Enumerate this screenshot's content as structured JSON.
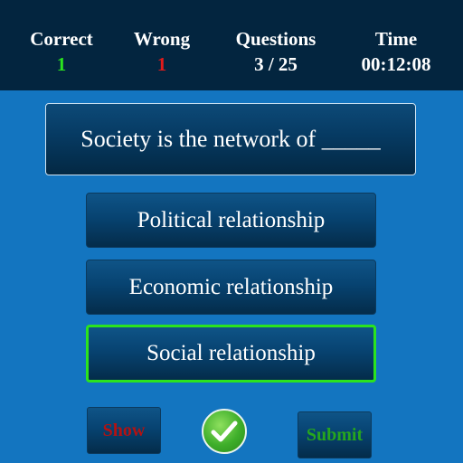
{
  "stats": {
    "correct": {
      "label": "Correct",
      "value": "1",
      "color": "#2be31e"
    },
    "wrong": {
      "label": "Wrong",
      "value": "1",
      "color": "#e01b1b"
    },
    "questions": {
      "label": "Questions",
      "value": "3 / 25"
    },
    "time": {
      "label": "Time",
      "value": "00:12:08"
    }
  },
  "question": "Society is the network of _____",
  "options": [
    {
      "label": "Political relationship",
      "selected": false
    },
    {
      "label": "Economic relationship",
      "selected": false
    },
    {
      "label": "Social relationship",
      "selected": true
    }
  ],
  "buttons": {
    "show_label": "Show",
    "submit_label": "Submit",
    "check_icon": "checkmark-icon"
  },
  "colors": {
    "background": "#1375c0",
    "header": "#03253f",
    "selected_border": "#2be31e"
  }
}
